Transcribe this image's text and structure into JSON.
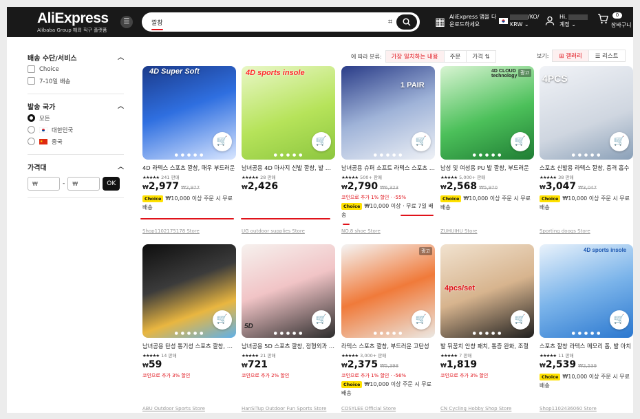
{
  "header": {
    "logo": "AliExpress",
    "logo_sub": "Alibaba Group 해외 직구 플랫폼",
    "search_value": "깔창",
    "app_promo_line1": "AliExpress 앱을 다",
    "app_promo_line2": "운로드하세요",
    "region_line1": "/KO/",
    "region_line2": "KRW",
    "account_line1": "Hi,",
    "account_line2": "계정",
    "cart_count": "0",
    "cart_label": "장바구니"
  },
  "sidebar": {
    "shipping_title": "배송 수단/서비스",
    "shipping_options": [
      "Choice",
      "7-10일 배송"
    ],
    "origin_title": "발송 국가",
    "origin_options": [
      "모든",
      "대한민국",
      "중국"
    ],
    "price_title": "가격대",
    "price_min_placeholder": "₩",
    "price_max_placeholder": "₩",
    "price_ok": "OK"
  },
  "sort": {
    "label": "에 따라 분류:",
    "options": [
      "가장 일치하는 내용",
      "주문",
      "가격"
    ],
    "view_label": "보기:",
    "view_options": [
      "갤러리",
      "리스트"
    ]
  },
  "products": [
    {
      "title": "4D 라텍스 스포츠 깔창, 매우 부드러운",
      "stars": "★★★★★",
      "sold": "241 판매",
      "cur": "₩",
      "price": "2,977",
      "old": "₩2,977",
      "promo": "",
      "ship1": "₩10,000 이상 주문 시 무료",
      "ship2": "배송",
      "choice": "Choice",
      "store": "Shop1102175178 Store",
      "img_text": "4D   Super Soft",
      "ad": ""
    },
    {
      "title": "남녀공용 4D 마사지 신발 깔창, 발 패드",
      "stars": "★★★★★",
      "sold": "28 판매",
      "cur": "₩",
      "price": "2,426",
      "old": "",
      "promo": "",
      "ship1": "",
      "ship2": "",
      "choice": "",
      "store": "UG outdoor supplies Store",
      "img_text": "4D sports insole",
      "ad": ""
    },
    {
      "title": "남녀공용 슈퍼 소프트 라텍스 스포츠 깔창",
      "stars": "★★★★★",
      "sold": "500+ 판매",
      "cur": "₩",
      "price": "2,790",
      "old": "₩6,323",
      "promo": "코인으로 추가 1% 할인 · -55%",
      "ship1": "₩10,000 이상 · 무료 7일 배",
      "ship2": "송",
      "choice": "Choice",
      "store": "NO.8 shoe Store",
      "img_text": "1 PAIR",
      "ad": ""
    },
    {
      "title": "남성 및 여성용 PU 발 깔창, 부드러운",
      "stars": "★★★★★",
      "sold": "5,000+ 판매",
      "cur": "₩",
      "price": "2,568",
      "old": "₩5,970",
      "promo": "",
      "ship1": "₩10,000 이상 주문 시 무료",
      "ship2": "배송",
      "choice": "Choice",
      "store": "ZUHUIHU Store",
      "img_text": "4D CLOUD technology",
      "ad": "광고"
    },
    {
      "title": "스포츠 신발용 라텍스 깔창, 충격 흡수",
      "stars": "★★★★★",
      "sold": "38 판매",
      "cur": "₩",
      "price": "3,047",
      "old": "₩3,047",
      "promo": "",
      "ship1": "₩10,000 이상 주문 시 무료",
      "ship2": "배송",
      "choice": "Choice",
      "store": "Sporting doogs Store",
      "img_text": "4PCS",
      "ad": ""
    },
    {
      "title": "남녀공용 탄성 통기성 스포츠 깔창, 러닝",
      "stars": "★★★★★",
      "sold": "14 판매",
      "cur": "₩",
      "price": "59",
      "old": "",
      "promo": "코인으로 추가 3% 할인",
      "ship1": "",
      "ship2": "",
      "choice": "",
      "store": "ABU Outdoor Sports Store",
      "img_text": "",
      "ad": ""
    },
    {
      "title": "남녀공용 5D 스포츠 깔창, 정형외과 패드",
      "stars": "★★★★★",
      "sold": "21 판매",
      "cur": "₩",
      "price": "721",
      "old": "",
      "promo": "코인으로 추가 2% 할인",
      "ship1": "",
      "ship2": "",
      "choice": "",
      "store": "HanSiTup Outdoor Fun Sports Store",
      "img_text": "5D",
      "ad": ""
    },
    {
      "title": "라텍스 스포츠 깔창, 부드러운 고탄성",
      "stars": "★★★★★",
      "sold": "3,000+ 판매",
      "cur": "₩",
      "price": "2,375",
      "old": "₩5,398",
      "promo": "코인으로 추가 1% 할인 · -56%",
      "ship1": "₩10,000 이상 주문 시 무료",
      "ship2": "배송",
      "choice": "Choice",
      "store": "COSYLEE Official Store",
      "img_text": "",
      "ad": "광고"
    },
    {
      "title": "발 뒤꿈치 안창 패치, 통증 완화, 조절",
      "stars": "★★★★★",
      "sold": "7 판매",
      "cur": "₩",
      "price": "1,819",
      "old": "",
      "promo": "코인으로 추가 3% 할인",
      "ship1": "",
      "ship2": "",
      "choice": "",
      "store": "CN Cycling Hobby Shop Store",
      "img_text": "4pcs/set",
      "ad": ""
    },
    {
      "title": "스포츠 깔창 라텍스 메모리 폼, 발 아치",
      "stars": "★★★★★",
      "sold": "11 판매",
      "cur": "₩",
      "price": "2,539",
      "old": "₩2,539",
      "promo": "",
      "ship1": "₩10,000 이상 주문 시 무료",
      "ship2": "배송",
      "choice": "Choice",
      "store": "Shop1102436060 Store",
      "img_text": "4D sports insole",
      "ad": ""
    }
  ],
  "colors": {
    "accent": "#e0121a",
    "header_bg": "#191919",
    "choice": "#ffe100"
  }
}
